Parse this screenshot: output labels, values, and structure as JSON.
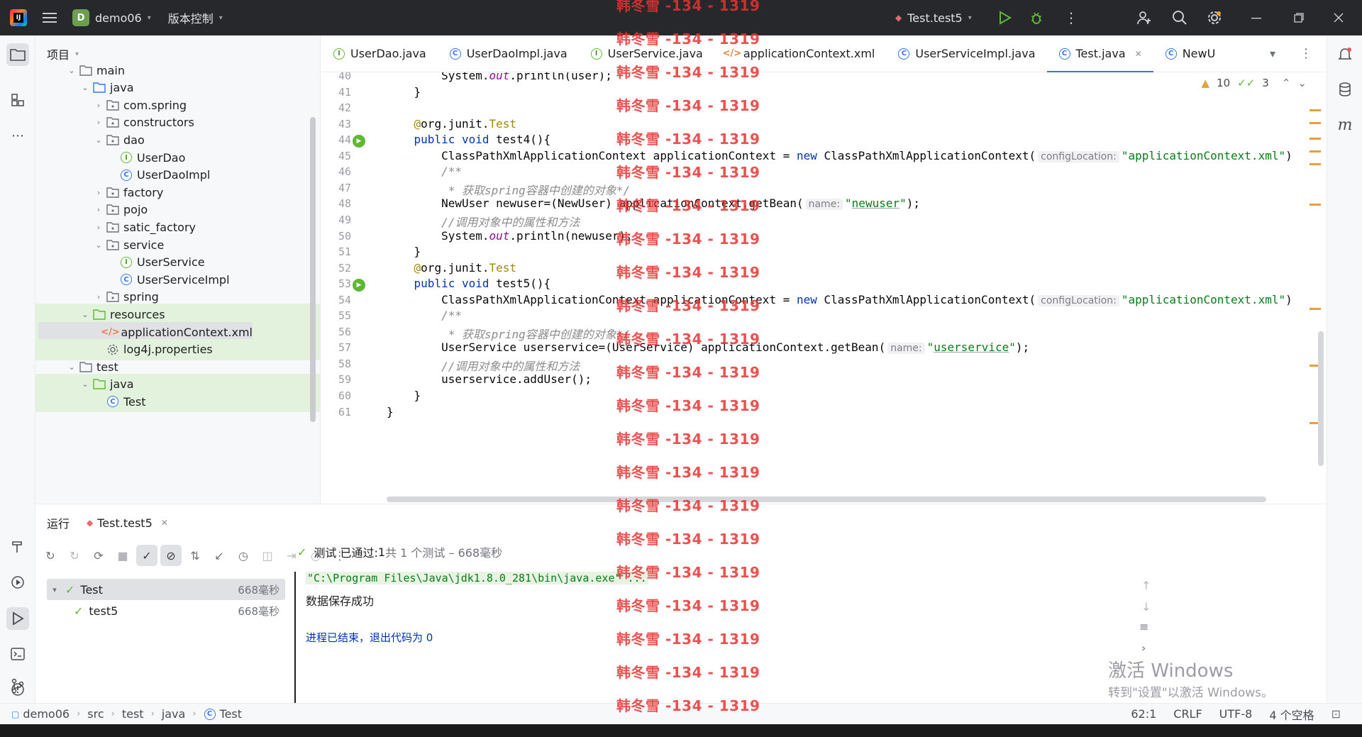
{
  "titlebar": {
    "project": "demo06",
    "project_letter": "D",
    "vcs": "版本控制",
    "run_config": "Test.test5"
  },
  "project_panel": {
    "title": "项目",
    "tree": [
      {
        "label": "main",
        "level": 2,
        "type": "folder",
        "arrow": "open"
      },
      {
        "label": "java",
        "level": 3,
        "type": "srcfolder",
        "arrow": "open"
      },
      {
        "label": "com.spring",
        "level": 4,
        "type": "package",
        "arrow": "closed"
      },
      {
        "label": "constructors",
        "level": 4,
        "type": "package",
        "arrow": "closed"
      },
      {
        "label": "dao",
        "level": 4,
        "type": "package",
        "arrow": "open"
      },
      {
        "label": "UserDao",
        "level": 5,
        "type": "interface"
      },
      {
        "label": "UserDaoImpl",
        "level": 5,
        "type": "class"
      },
      {
        "label": "factory",
        "level": 4,
        "type": "package",
        "arrow": "closed"
      },
      {
        "label": "pojo",
        "level": 4,
        "type": "package",
        "arrow": "closed"
      },
      {
        "label": "satic_factory",
        "level": 4,
        "type": "package",
        "arrow": "closed"
      },
      {
        "label": "service",
        "level": 4,
        "type": "package",
        "arrow": "open"
      },
      {
        "label": "UserService",
        "level": 5,
        "type": "interface"
      },
      {
        "label": "UserServiceImpl",
        "level": 5,
        "type": "class"
      },
      {
        "label": "spring",
        "level": 4,
        "type": "package",
        "arrow": "closed"
      },
      {
        "label": "resources",
        "level": 3,
        "type": "resfolder",
        "arrow": "open",
        "hl": true
      },
      {
        "label": "applicationContext.xml",
        "level": 4,
        "type": "xml",
        "hl": true,
        "sel": true
      },
      {
        "label": "log4j.properties",
        "level": 4,
        "type": "props",
        "hl": true
      },
      {
        "label": "test",
        "level": 2,
        "type": "folder",
        "arrow": "open"
      },
      {
        "label": "java",
        "level": 3,
        "type": "testfolder",
        "arrow": "open",
        "hl": true
      },
      {
        "label": "Test",
        "level": 4,
        "type": "class",
        "hl": true
      }
    ]
  },
  "editor_tabs": [
    {
      "label": "UserDao.java",
      "icon": "interface"
    },
    {
      "label": "UserDaoImpl.java",
      "icon": "class"
    },
    {
      "label": "UserService.java",
      "icon": "interface"
    },
    {
      "label": "applicationContext.xml",
      "icon": "xml"
    },
    {
      "label": "UserServiceImpl.java",
      "icon": "class"
    },
    {
      "label": "Test.java",
      "icon": "class",
      "active": true
    },
    {
      "label": "NewU",
      "icon": "class"
    }
  ],
  "inspections": {
    "warnings": "10",
    "weak": "3"
  },
  "line_numbers": [
    "40",
    "41",
    "42",
    "43",
    "44",
    "45",
    "46",
    "47",
    "48",
    "49",
    "50",
    "51",
    "52",
    "53",
    "54",
    "55",
    "56",
    "57",
    "58",
    "59",
    "60",
    "61"
  ],
  "code_lines": [
    [
      [
        "",
        "        System."
      ],
      [
        "fld",
        "out"
      ],
      [
        "",
        ".println(user);"
      ]
    ],
    [
      [
        "",
        "    }"
      ]
    ],
    [
      [
        "",
        ""
      ]
    ],
    [
      [
        "ann",
        "    @"
      ],
      [
        "",
        "org.junit."
      ],
      [
        "tst",
        "Test"
      ]
    ],
    [
      [
        "kw",
        "    public void "
      ],
      [
        "",
        "test4(){"
      ]
    ],
    [
      [
        "",
        "        ClassPathXmlApplicationContext applicationContext = "
      ],
      [
        "kw",
        "new "
      ],
      [
        "",
        "ClassPathXmlApplicationContext("
      ],
      [
        "hint",
        "configLocation:"
      ],
      [
        "str",
        "\"applicationContext.xml\""
      ],
      [
        "",
        ")"
      ]
    ],
    [
      [
        "cmt",
        "        /**"
      ]
    ],
    [
      [
        "cmt",
        "         * 获取spring容器中创建的对象*/"
      ]
    ],
    [
      [
        "",
        "        NewUser newuser=(NewUser) applicationContext.getBean("
      ],
      [
        "hint",
        "name:"
      ],
      [
        "str",
        "\""
      ],
      [
        "stru",
        "newuser"
      ],
      [
        "str",
        "\""
      ],
      [
        "",
        ");"
      ]
    ],
    [
      [
        "cmt",
        "        //调用对象中的属性和方法"
      ]
    ],
    [
      [
        "",
        "        System."
      ],
      [
        "fld",
        "out"
      ],
      [
        "",
        ".println(newuser);"
      ]
    ],
    [
      [
        "",
        "    }"
      ]
    ],
    [
      [
        "ann",
        "    @"
      ],
      [
        "",
        "org.junit."
      ],
      [
        "tst",
        "Test"
      ]
    ],
    [
      [
        "kw",
        "    public void "
      ],
      [
        "",
        "test5(){"
      ]
    ],
    [
      [
        "",
        "        ClassPathXmlApplicationContext applicationContext = "
      ],
      [
        "kw",
        "new "
      ],
      [
        "",
        "ClassPathXmlApplicationContext("
      ],
      [
        "hint",
        "configLocation:"
      ],
      [
        "str",
        "\"applicationContext.xml\""
      ],
      [
        "",
        ")"
      ]
    ],
    [
      [
        "cmt",
        "        /**"
      ]
    ],
    [
      [
        "cmt",
        "         * 获取spring容器中创建的对象*/"
      ]
    ],
    [
      [
        "",
        "        UserService userservice=(UserService) applicationContext.getBean("
      ],
      [
        "hint",
        "name:"
      ],
      [
        "str",
        "\""
      ],
      [
        "stru",
        "userservice"
      ],
      [
        "str",
        "\""
      ],
      [
        "",
        ");"
      ]
    ],
    [
      [
        "cmt",
        "        //调用对象中的属性和方法"
      ]
    ],
    [
      [
        "",
        "        userservice.addUser();"
      ]
    ],
    [
      [
        "",
        "    }"
      ]
    ],
    [
      [
        "",
        "}"
      ]
    ]
  ],
  "run_panel": {
    "tab_run": "运行",
    "tab_config": "Test.test5",
    "status_text": "测试 已通过:",
    "status_count": "1",
    "status_detail": "共 1 个测试 – 668毫秒",
    "tree": [
      {
        "label": "Test",
        "time": "668毫秒"
      },
      {
        "label": "test5",
        "time": "668毫秒"
      }
    ],
    "console": [
      "\"C:\\Program Files\\Java\\jdk1.8.0_281\\bin\\java.exe\" ...",
      "数据保存成功",
      "",
      "进程已结束，退出代码为 0"
    ]
  },
  "breadcrumb": [
    "demo06",
    "src",
    "test",
    "java",
    "Test"
  ],
  "statusbar": {
    "position": "62:1",
    "line_sep": "CRLF",
    "encoding": "UTF-8",
    "indent": "4 个空格"
  },
  "watermark": "韩冬雪 -134 - 1319",
  "activate": {
    "line1": "激活 Windows",
    "line2": "转到\"设置\"以激活 Windows。"
  }
}
